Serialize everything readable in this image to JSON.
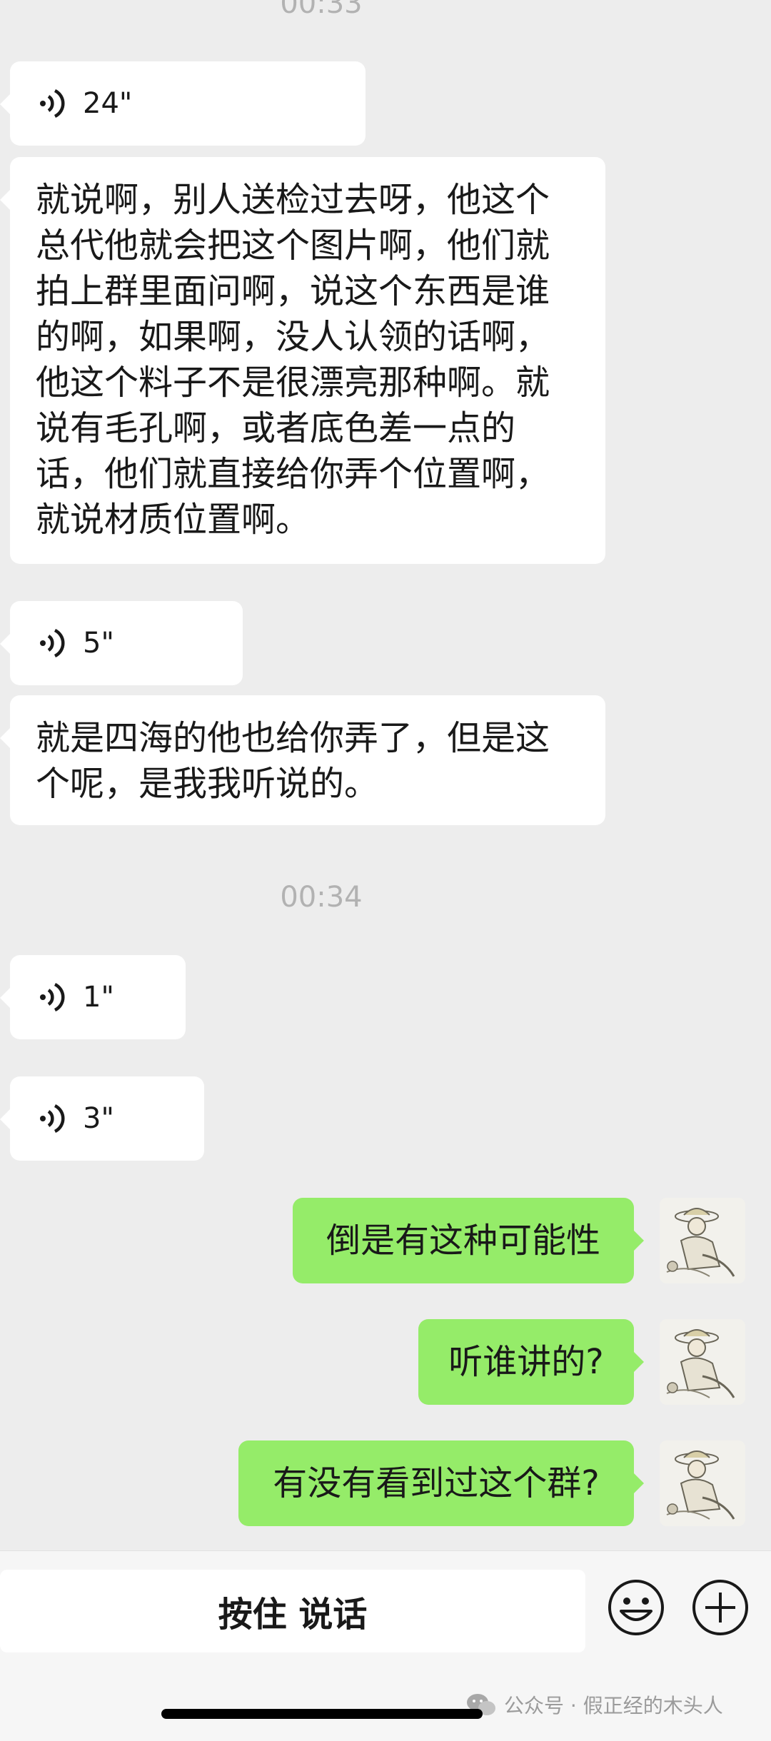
{
  "timestamps": [
    "00:33",
    "00:34"
  ],
  "messages": {
    "voice_24": {
      "duration": "24\""
    },
    "text_1": {
      "text": "就说啊，别人送检过去呀，他这个总代他就会把这个图片啊，他们就拍上群里面问啊，说这个东西是谁的啊，如果啊，没人认领的话啊，他这个料子不是很漂亮那种啊。就说有毛孔啊，或者底色差一点的话，他们就直接给你弄个位置啊，就说材质位置啊。"
    },
    "voice_5": {
      "duration": "5\""
    },
    "text_2": {
      "text": "就是四海的他也给你弄了，但是这个呢，是我我听说的。"
    },
    "voice_1": {
      "duration": "1\""
    },
    "voice_3": {
      "duration": "3\""
    },
    "reply_1": {
      "text": "倒是有这种可能性"
    },
    "reply_2": {
      "text": "听谁讲的?"
    },
    "reply_3": {
      "text": "有没有看到过这个群?"
    }
  },
  "input_bar": {
    "hold_to_talk": "按住 说话",
    "emoji_icon": "smiley-face",
    "plus_icon": "plus"
  },
  "watermark": {
    "text": "公众号 · 假正经的木头人"
  },
  "colors": {
    "background": "#ededed",
    "incoming_bubble": "#ffffff",
    "outgoing_bubble": "#95ec69",
    "timestamp": "#b2b2b2"
  }
}
